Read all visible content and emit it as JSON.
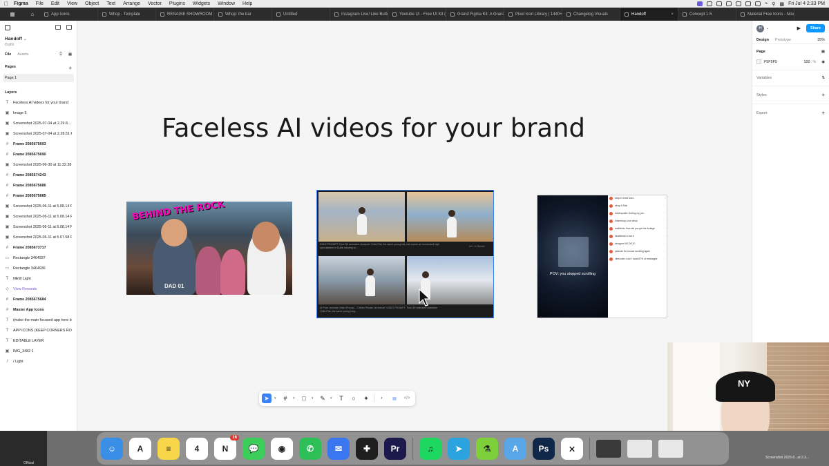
{
  "menubar": {
    "app": "Figma",
    "items": [
      "File",
      "Edit",
      "View",
      "Object",
      "Text",
      "Arrange",
      "Vector",
      "Plugins",
      "Widgets",
      "Window",
      "Help"
    ],
    "datetime": "Fri Jul 4  2:33 PM"
  },
  "tabs": [
    {
      "label": "App Icons",
      "active": false
    },
    {
      "label": "Whop - Template",
      "active": false
    },
    {
      "label": "RENAISE SHOWROOM / BRA",
      "active": false
    },
    {
      "label": "Whop: the bar",
      "active": false
    },
    {
      "label": "Untitled",
      "active": false
    },
    {
      "label": "Instagram Live! Like Button",
      "active": false
    },
    {
      "label": "Youtube UI - Free UI Kit (Rec",
      "active": false
    },
    {
      "label": "Grand Figma Kit: A Grand Th",
      "active": false
    },
    {
      "label": "Pixel Icon Library | 1440+ Ic",
      "active": false
    },
    {
      "label": "Changelog Visuals",
      "active": false
    },
    {
      "label": "Handoff",
      "active": true
    },
    {
      "label": "Concept 1.5",
      "active": false
    },
    {
      "label": "Material Free Icons - Nova V",
      "active": false
    }
  ],
  "leftpanel": {
    "file_name": "Handoff",
    "location": "Drafts",
    "tab_file": "File",
    "tab_assets": "Assets",
    "pages_heading": "Pages",
    "current_page": "Page 1",
    "layers_heading": "Layers",
    "layers": [
      {
        "icon": "T",
        "name": "Faceless AI videos for your brand",
        "kind": "text"
      },
      {
        "icon": "▣",
        "name": "Image 5",
        "kind": "image"
      },
      {
        "icon": "▣",
        "name": "Screenshot 2025-07-04 at 2.29.8...",
        "kind": "image"
      },
      {
        "icon": "▣",
        "name": "Screenshot 2025-07-04 at 2.28.51 PM",
        "kind": "image"
      },
      {
        "icon": "#",
        "name": "Frame 2085675693",
        "kind": "frame"
      },
      {
        "icon": "#",
        "name": "Frame 2085675690",
        "kind": "frame"
      },
      {
        "icon": "▣",
        "name": "Screenshot 2025-06-30 at 11.32.38 PM",
        "kind": "image"
      },
      {
        "icon": "#",
        "name": "Frame 2085674243",
        "kind": "frame"
      },
      {
        "icon": "#",
        "name": "Frame 2085675686",
        "kind": "frame"
      },
      {
        "icon": "#",
        "name": "Frame 2085675685",
        "kind": "frame"
      },
      {
        "icon": "▣",
        "name": "Screenshot 2025-06-11 at 5.08.14 PM",
        "kind": "image"
      },
      {
        "icon": "▣",
        "name": "Screenshot 2025-06-11 at 5.08.14 PM",
        "kind": "image"
      },
      {
        "icon": "▣",
        "name": "Screenshot 2025-06-11 at 5.08.14 PM",
        "kind": "image"
      },
      {
        "icon": "▣",
        "name": "Screenshot 2025-06-11 at 5.07.58 PM",
        "kind": "image"
      },
      {
        "icon": "#",
        "name": "Frame 2085673717",
        "kind": "frame"
      },
      {
        "icon": "▭",
        "name": "Rectangle 3464937",
        "kind": "rect"
      },
      {
        "icon": "▭",
        "name": "Rectangle 3464936",
        "kind": "rect"
      },
      {
        "icon": "T",
        "name": "NEW  Light",
        "kind": "text"
      },
      {
        "icon": "◇",
        "name": "View Rewards",
        "kind": "component"
      },
      {
        "icon": "#",
        "name": "Frame 2085675684",
        "kind": "frame"
      },
      {
        "icon": "#",
        "name": "Master App Icons",
        "kind": "frame"
      },
      {
        "icon": "T",
        "name": "(make the main focused app here bou",
        "kind": "text"
      },
      {
        "icon": "T",
        "name": "APP ICONS (KEEP CORNERS ROUNDE",
        "kind": "text"
      },
      {
        "icon": "T",
        "name": "EDITABLE LAYER",
        "kind": "text"
      },
      {
        "icon": "▣",
        "name": "IMG_3482 1",
        "kind": "image"
      },
      {
        "icon": "/",
        "name": "/  Light",
        "kind": "text"
      }
    ]
  },
  "canvas": {
    "headline": "Faceless AI videos for your brand",
    "thumb1_badge": "BEHIND THE ROCK",
    "thumb1_shirt": "DAD 01",
    "thumb2_caption_top": "ROLE PROMPT: Time 3D animated character Chibi-Plat, the same young sits, eat counts an remainded high speculations in Dubai wearing ar...",
    "thumb2_caption_bottom": "AI Pure: Animate Video Prompt - \"Chibi's Private Jet Arrival\" VIDEO PROMPT: Time 3D animated character Chibi-Plat, the same young long...",
    "thumb2_meta": "Inf 1  1x  Render",
    "thumb3_pov": "POV: you stopped scrolling",
    "thumb3_comments": [
      "wtop.fi  Great work",
      "whop.fi  Sick",
      "buildinpublic  Getting my job...",
      "kristenbug  Love whop",
      "karthkodu  How did you get the footage",
      "beatstream  Love it",
      "whopper  NO DOJO",
      "paleoak  No mouse scrolling again",
      "vibecoder  Love I hand 87% of messages"
    ]
  },
  "toolbar": {
    "tools": [
      {
        "name": "move-tool",
        "glyph": "➤",
        "active": true
      },
      {
        "name": "frame-tool",
        "glyph": "#",
        "active": false
      },
      {
        "name": "shape-tool",
        "glyph": "□",
        "active": false
      },
      {
        "name": "pen-tool",
        "glyph": "✎",
        "active": false
      },
      {
        "name": "text-tool",
        "glyph": "T",
        "active": false
      },
      {
        "name": "comment-tool",
        "glyph": "○",
        "active": false
      },
      {
        "name": "actions-tool",
        "glyph": "✦",
        "active": false
      }
    ],
    "dev_glyphs": [
      "◐",
      "▤",
      "</>"
    ]
  },
  "rightpanel": {
    "avatar_letter": "H",
    "share_label": "Share",
    "tab_design": "Design",
    "tab_prototype": "Prototype",
    "zoom": "35%",
    "page_heading": "Page",
    "page_color": "F5F5F5",
    "page_opacity": "100",
    "percent_sign": "%",
    "variables": "Variables",
    "styles": "Styles",
    "export": "Export"
  },
  "dock": {
    "apps": [
      {
        "name": "finder",
        "letter": "☺",
        "color": "#3a8ee6"
      },
      {
        "name": "affinity",
        "letter": "A",
        "color": "#ffffff"
      },
      {
        "name": "notes",
        "letter": "≡",
        "color": "#f7d64a"
      },
      {
        "name": "calendar",
        "letter": "4",
        "color": "#ffffff"
      },
      {
        "name": "notion",
        "letter": "N",
        "color": "#ffffff",
        "badge": "16"
      },
      {
        "name": "messages",
        "letter": "💬",
        "color": "#3ccd5b"
      },
      {
        "name": "chrome",
        "letter": "◉",
        "color": "#ffffff"
      },
      {
        "name": "whatsapp",
        "letter": "✆",
        "color": "#2fbf58"
      },
      {
        "name": "signal",
        "letter": "✉",
        "color": "#3a76f0"
      },
      {
        "name": "figma",
        "letter": "✚",
        "color": "#1e1e1e"
      },
      {
        "name": "premiere",
        "letter": "Pr",
        "color": "#1c1a4c"
      },
      {
        "name": "spotify",
        "letter": "♫",
        "color": "#1ed760"
      },
      {
        "name": "telegram",
        "letter": "➤",
        "color": "#2aa3df"
      },
      {
        "name": "script-editor",
        "letter": "⚗",
        "color": "#7ed03a"
      },
      {
        "name": "maps",
        "letter": "A",
        "color": "#5aa7e8"
      },
      {
        "name": "photoshop",
        "letter": "Ps",
        "color": "#0f2748"
      },
      {
        "name": "capcut",
        "letter": "⨯",
        "color": "#ffffff"
      }
    ],
    "bottom_left_label": "Official",
    "bottom_right_label": "Screenshot 2025-0...at 2.3..."
  }
}
